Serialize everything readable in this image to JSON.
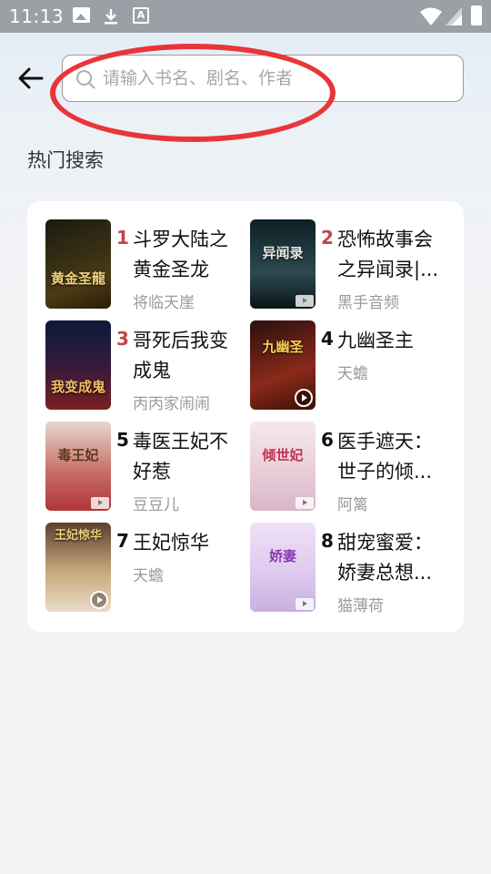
{
  "status_bar": {
    "time": "11:13",
    "icons": [
      "image-icon",
      "download-icon",
      "font-icon",
      "wifi-icon",
      "signal-icon",
      "battery-icon"
    ]
  },
  "header": {
    "back_icon": "arrow-left-icon",
    "search": {
      "placeholder": "请输入书名、剧名、作者",
      "value": ""
    }
  },
  "hot_search": {
    "title": "热门搜索",
    "items": [
      {
        "rank": "1",
        "title": "斗罗大陆之黄金圣龙",
        "author": "将临天崖",
        "cover_text": "黄金圣龍",
        "cover_colors": [
          "#1a1a12",
          "#4a3c14"
        ],
        "badge": "none",
        "hot": true
      },
      {
        "rank": "2",
        "title": "恐怖故事会之异闻录|...",
        "author": "黑手音频",
        "cover_text": "异闻录",
        "cover_colors": [
          "#0d1f24",
          "#2d4a50"
        ],
        "badge": "tag",
        "hot": true
      },
      {
        "rank": "3",
        "title": "哥死后我变成鬼",
        "author": "丙丙家闹闹",
        "cover_text": "我变成鬼",
        "cover_colors": [
          "#0b1a3a",
          "#7a1f1f"
        ],
        "badge": "none",
        "hot": true
      },
      {
        "rank": "4",
        "title": "九幽圣主",
        "author": "天蟾",
        "cover_text": "九幽圣",
        "cover_colors": [
          "#2a0f0f",
          "#8a2a1a"
        ],
        "badge": "circle",
        "hot": false
      },
      {
        "rank": "5",
        "title": "毒医王妃不好惹",
        "author": "豆豆儿",
        "cover_text": "毒王妃",
        "cover_colors": [
          "#e8d6cf",
          "#b0343a"
        ],
        "badge": "tag",
        "hot": false
      },
      {
        "rank": "6",
        "title": "医手遮天：世子的倾...",
        "author": "阿篱",
        "cover_text": "倾世妃",
        "cover_colors": [
          "#f5e8ee",
          "#d8b6c8"
        ],
        "badge": "tag",
        "hot": false
      },
      {
        "rank": "7",
        "title": "王妃惊华",
        "author": "天蟾",
        "cover_text": "王妃惊华",
        "cover_colors": [
          "#5a4030",
          "#c9a87a"
        ],
        "badge": "circle",
        "hot": false
      },
      {
        "rank": "8",
        "title": "甜宠蜜爱：娇妻总想...",
        "author": "猫薄荷",
        "cover_text": "娇妻",
        "cover_colors": [
          "#efe2f5",
          "#c9b0e0"
        ],
        "badge": "tag",
        "hot": false
      }
    ]
  },
  "colors": {
    "accent_rank": "#c0444a",
    "highlight": "#e8353a"
  }
}
